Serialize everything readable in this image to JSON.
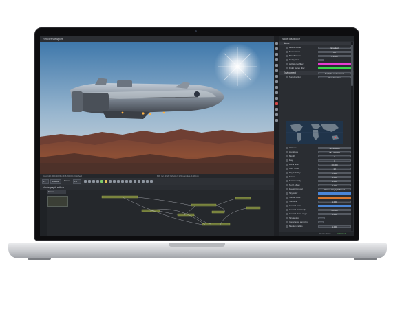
{
  "viewport": {
    "title": "Render viewport",
    "status_left": "Cpu: 110.00% 1024 x 576, 60.0% Finished",
    "status_right": "80h rec, 1920 [Shutter] 120 samples, 1024 px"
  },
  "toolbar": {
    "kernel": "PT",
    "camera": "SCENE",
    "frame_label": "Frame",
    "frame_value": "1.0"
  },
  "nodegraph": {
    "title": "Nodegraph editor",
    "tab": "Scene"
  },
  "inspector": {
    "title": "Node inspector",
    "sections": [
      {
        "label": "Name"
      },
      {
        "label": "Environment",
        "value": "Daylight environment"
      },
      {
        "label": "Visible environment"
      }
    ],
    "name_rows": [
      {
        "label": "Before output",
        "value": "Enabled"
      },
      {
        "label": "Name mode",
        "value": "Off"
      },
      {
        "label": "Bits distance",
        "value": "0.1000"
      },
      {
        "label": "Today start",
        "value": ""
      },
      {
        "label": "Left stereo filter",
        "value": ""
      },
      {
        "label": "Right stereo filter",
        "value": ""
      }
    ],
    "env_rows": [
      {
        "label": "Sun direction",
        "value": "Sun direction"
      },
      {
        "label": "Latitude",
        "value": "-33.400000"
      },
      {
        "label": "Longitude",
        "value": "151.200000"
      },
      {
        "label": "Month",
        "value": "3"
      },
      {
        "label": "Day",
        "value": "1"
      },
      {
        "label": "Local time",
        "value": "10.000"
      },
      {
        "label": "GMT offset",
        "value": "10"
      },
      {
        "label": "Sky turbidity",
        "value": "2.400"
      },
      {
        "label": "Power",
        "value": "1.000"
      },
      {
        "label": "Sun intensity",
        "value": "1.000"
      },
      {
        "label": "North offset",
        "value": "0.000"
      },
      {
        "label": "Daylight model",
        "value": "Octane Daylight Model"
      },
      {
        "label": "Sky color",
        "value": ""
      },
      {
        "label": "Sunset color",
        "value": ""
      },
      {
        "label": "Sun size",
        "value": "1.000"
      },
      {
        "label": "Ground color",
        "value": ""
      },
      {
        "label": "Ground start angle",
        "value": "90.000"
      },
      {
        "label": "Ground blend angle",
        "value": "5.000"
      },
      {
        "label": "Sky texture",
        "value": ""
      },
      {
        "label": "Importance sampling",
        "value": ""
      },
      {
        "label": "Medium",
        "value": ""
      },
      {
        "label": "Medium radius",
        "value": "1.000"
      }
    ],
    "vis_rows": [
      {
        "label": "Backplate",
        "value": ""
      },
      {
        "label": "Reflections",
        "value": ""
      },
      {
        "label": "Refractions",
        "value": ""
      }
    ],
    "status_left": "Connections",
    "status_right": "Activated"
  },
  "colors": {
    "sky_top": "#4a7fb0",
    "sky_bottom": "#c7d6e3",
    "terrain": "#8a4d34",
    "magenta_swatch": "#e83ad2",
    "green_swatch": "#38d64a",
    "blue_swatch": "#4a86d8",
    "orange_swatch": "#d9772c"
  }
}
